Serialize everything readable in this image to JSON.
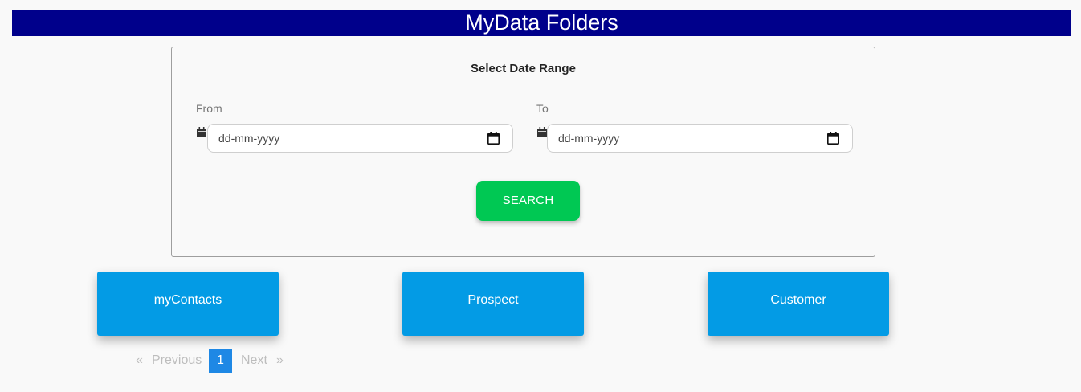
{
  "header": {
    "title": "MyData Folders"
  },
  "search_panel": {
    "heading": "Select Date Range",
    "from": {
      "label": "From",
      "placeholder": "dd-mm-yyyy"
    },
    "to": {
      "label": "To",
      "placeholder": "dd-mm-yyyy"
    },
    "search_label": "SEARCH"
  },
  "folders": [
    {
      "label": "myContacts"
    },
    {
      "label": "Prospect"
    },
    {
      "label": "Customer"
    }
  ],
  "pagination": {
    "prev_arrow": "«",
    "prev_label": "Previous",
    "current_page": "1",
    "next_label": "Next",
    "next_arrow": "»"
  },
  "colors": {
    "header_bg": "#00008b",
    "search_button": "#00c853",
    "folder_card": "#039be5",
    "current_page": "#1e88e5"
  },
  "icons": {
    "field_icon": "calendar-icon",
    "picker_icon": "calendar-picker-icon"
  }
}
